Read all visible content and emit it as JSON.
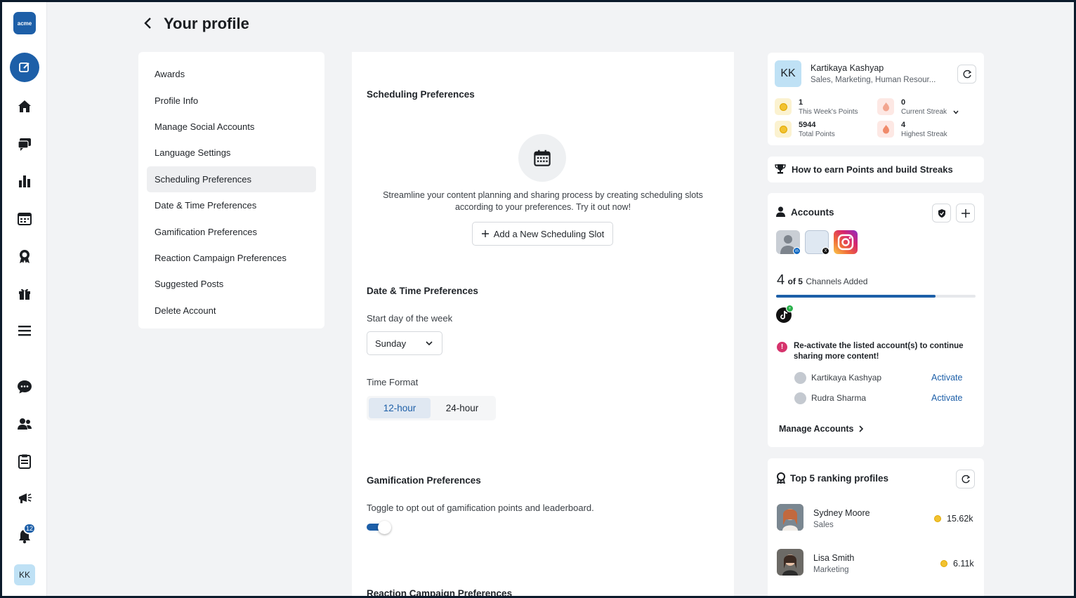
{
  "app": {
    "logo_text": "acme"
  },
  "header": {
    "title": "Your profile"
  },
  "rail": {
    "notification_count": "12",
    "user_initials": "KK"
  },
  "settings_nav": {
    "items": [
      {
        "label": "Awards"
      },
      {
        "label": "Profile Info"
      },
      {
        "label": "Manage Social Accounts"
      },
      {
        "label": "Language Settings"
      },
      {
        "label": "Scheduling Preferences"
      },
      {
        "label": "Date & Time Preferences"
      },
      {
        "label": "Gamification Preferences"
      },
      {
        "label": "Reaction Campaign Preferences"
      },
      {
        "label": "Suggested Posts"
      },
      {
        "label": "Delete Account"
      }
    ],
    "active_index": 4
  },
  "scheduling": {
    "title": "Scheduling Preferences",
    "description_line1": "Streamline your content planning and sharing process by creating scheduling slots",
    "description_line2": "according to your preferences. Try it out now!",
    "add_button_label": "Add a New Scheduling Slot"
  },
  "datetime": {
    "title": "Date & Time Preferences",
    "start_day_label": "Start day of the week",
    "start_day_value": "Sunday",
    "time_format_label": "Time Format",
    "time_format_options": [
      "12-hour",
      "24-hour"
    ],
    "time_format_selected": "12-hour"
  },
  "gamification": {
    "title": "Gamification Preferences",
    "description": "Toggle to opt out of gamification points and leaderboard.",
    "enabled": true
  },
  "reaction": {
    "title": "Reaction Campaign Preferences"
  },
  "profile_card": {
    "initials": "KK",
    "name": "Kartikaya Kashyap",
    "departments": "Sales, Marketing, Human Resour...",
    "stats": {
      "week_points": "1",
      "week_points_label": "This Week's Points",
      "current_streak": "0",
      "current_streak_label": "Current Streak",
      "total_points": "5944",
      "total_points_label": "Total Points",
      "highest_streak": "4",
      "highest_streak_label": "Highest Streak"
    }
  },
  "earn_card": {
    "title": "How to earn Points and build Streaks"
  },
  "accounts": {
    "title": "Accounts",
    "channels_added": "4",
    "channels_total_text": "of 5",
    "channels_suffix": "Channels Added",
    "progress_fraction": 0.8,
    "warning": "Re-activate the listed account(s) to continue sharing more content!",
    "inactive": [
      {
        "name": "Kartikaya Kashyap",
        "action": "Activate"
      },
      {
        "name": "Rudra Sharma",
        "action": "Activate"
      }
    ],
    "manage_label": "Manage Accounts"
  },
  "ranking": {
    "title": "Top 5 ranking profiles",
    "profiles": [
      {
        "name": "Sydney Moore",
        "dept": "Sales",
        "points": "15.62k"
      },
      {
        "name": "Lisa Smith",
        "dept": "Marketing",
        "points": "6.11k"
      }
    ]
  },
  "colors": {
    "accent": "#1d5fa8",
    "background": "#f2f3f5",
    "warning": "#d6336c"
  }
}
